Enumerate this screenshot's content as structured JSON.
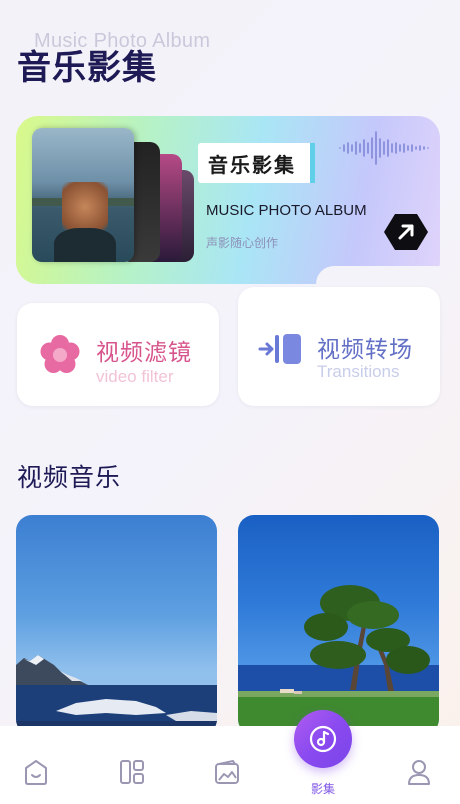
{
  "header": {
    "watermark": "Music Photo Album",
    "title": "音乐影集"
  },
  "banner": {
    "tag": "音乐影集",
    "title_en": "MUSIC PHOTO ALBUM",
    "subtitle": "声影随心创作"
  },
  "features": {
    "filter": {
      "title": "视频滤镜",
      "subtitle": "video filter"
    },
    "transitions": {
      "title": "视频转场",
      "subtitle": "Transitions"
    }
  },
  "section": {
    "title": "视频音乐"
  },
  "bottom_nav": {
    "items": [
      {
        "icon": "smile-icon"
      },
      {
        "icon": "layout-icon"
      },
      {
        "icon": "wallet-icon"
      },
      {
        "icon": "music-disc-icon",
        "label": "影集",
        "active": true
      },
      {
        "icon": "profile-icon"
      }
    ]
  },
  "colors": {
    "accent_purple": "#8a4af0",
    "filter_pink": "#d7558d",
    "transition_blue": "#6370c6",
    "title_navy": "#1e1a55"
  }
}
